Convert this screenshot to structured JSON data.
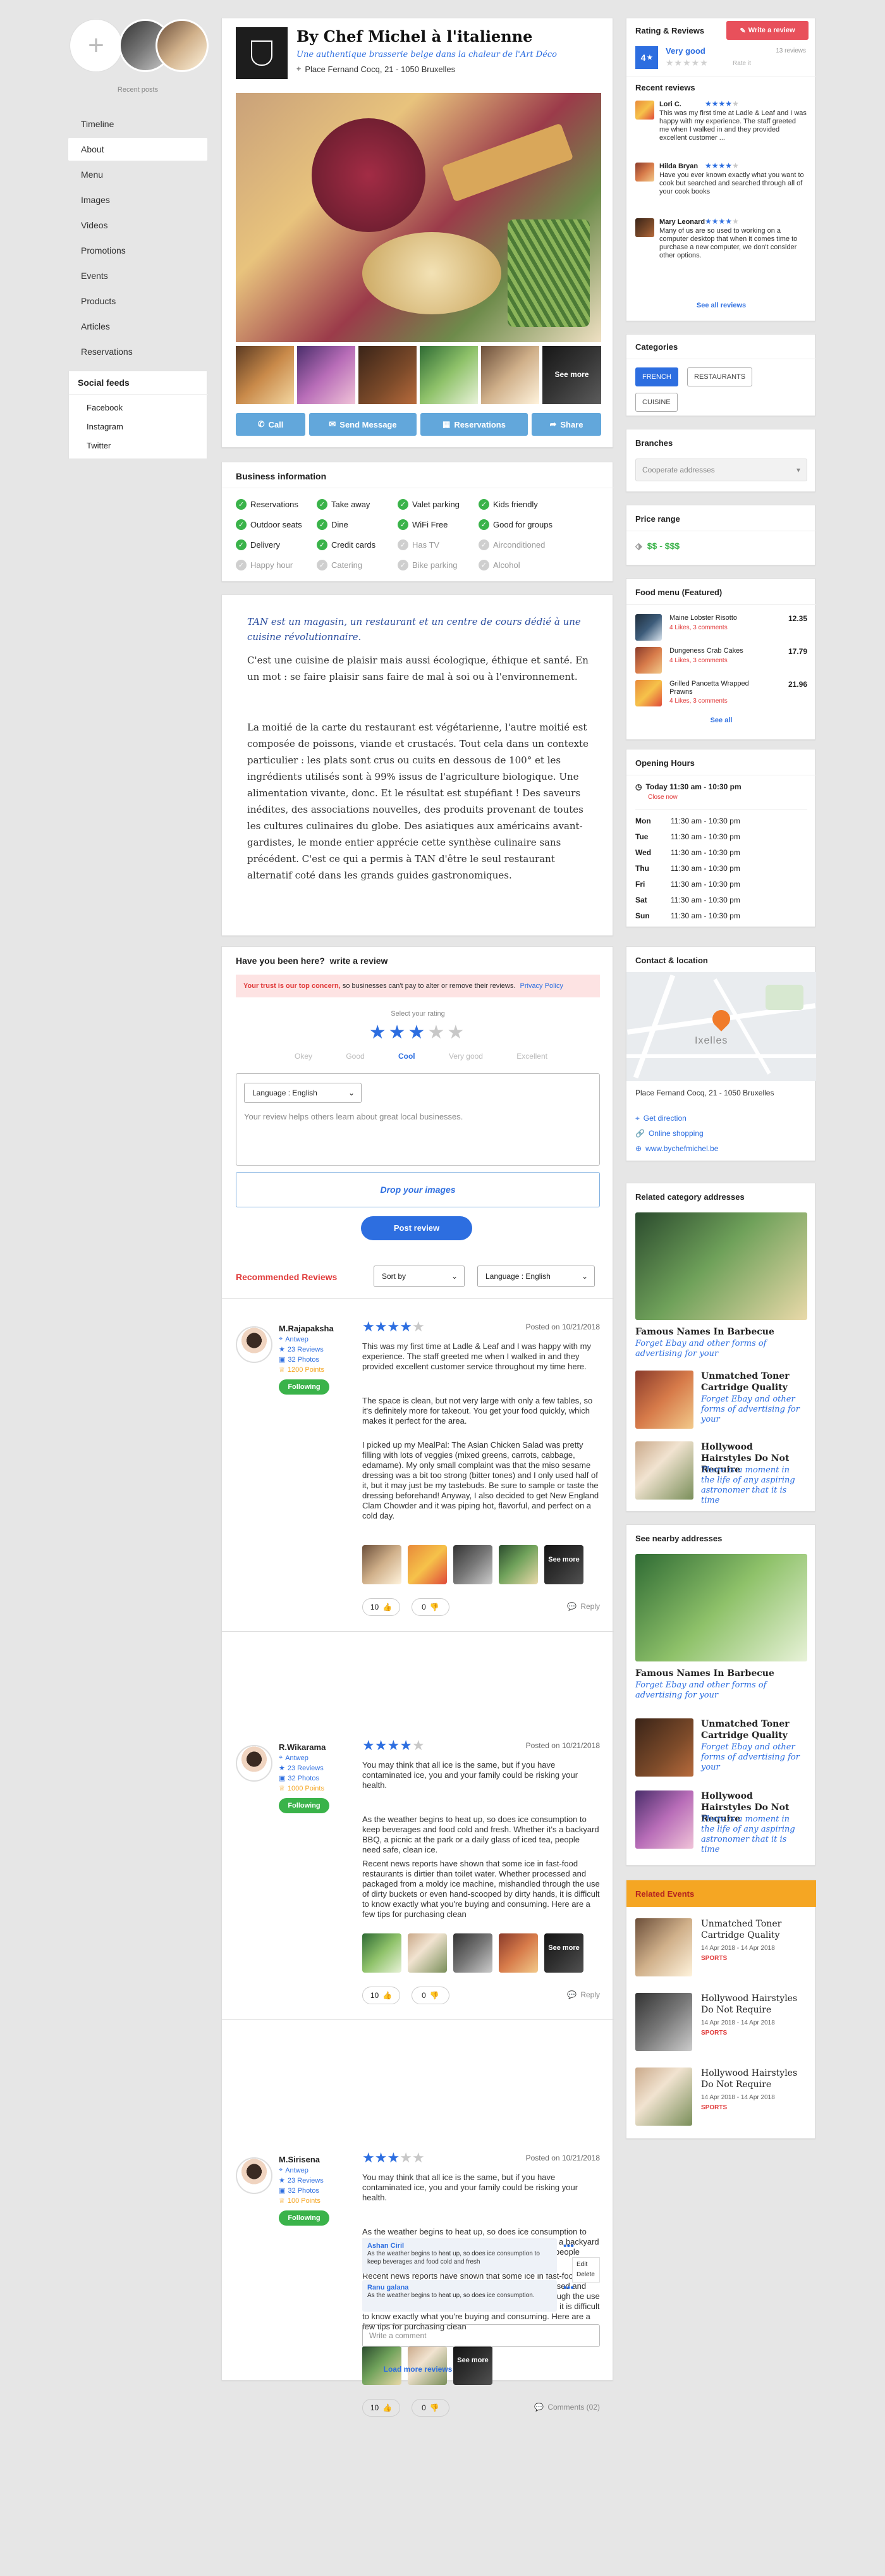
{
  "recent_posts": {
    "label": "Recent posts"
  },
  "nav": [
    {
      "label": "Timeline"
    },
    {
      "label": "About"
    },
    {
      "label": "Menu"
    },
    {
      "label": "Images"
    },
    {
      "label": "Videos"
    },
    {
      "label": "Promotions"
    },
    {
      "label": "Events"
    },
    {
      "label": "Products"
    },
    {
      "label": "Articles"
    },
    {
      "label": "Reservations"
    }
  ],
  "social": {
    "title": "Social feeds",
    "items": [
      "Facebook",
      "Instagram",
      "Twitter"
    ]
  },
  "business": {
    "name": "By Chef Michel à l'italienne",
    "tagline": "Une authentique brasserie belge dans la chaleur de l'Art Déco",
    "address": "Place Fernand Cocq, 21 - 1050 Bruxelles",
    "see_more": "See more",
    "actions": [
      "Call",
      "Send Message",
      "Reservations",
      "Share"
    ]
  },
  "business_info": {
    "title": "Business information",
    "items": [
      {
        "label": "Reservations",
        "on": true
      },
      {
        "label": "Take away",
        "on": true
      },
      {
        "label": "Valet parking",
        "on": true
      },
      {
        "label": "Kids friendly",
        "on": true
      },
      {
        "label": "Outdoor seats",
        "on": true
      },
      {
        "label": "Dine",
        "on": true
      },
      {
        "label": "WiFi Free",
        "on": true
      },
      {
        "label": "Good for groups",
        "on": true
      },
      {
        "label": "Delivery",
        "on": true
      },
      {
        "label": "Credit cards",
        "on": true
      },
      {
        "label": "Has TV",
        "on": false
      },
      {
        "label": "Airconditioned",
        "on": false
      },
      {
        "label": "Happy hour",
        "on": false
      },
      {
        "label": "Catering",
        "on": false
      },
      {
        "label": "Bike parking",
        "on": false
      },
      {
        "label": "Alcohol",
        "on": false
      }
    ]
  },
  "about": {
    "lead": "TAN est un magasin, un restaurant et un centre de cours dédié à une cuisine révolutionnaire.",
    "p1": "C'est une cuisine de plaisir mais aussi écologique, éthique et santé. En un mot : se faire plaisir sans faire de mal à soi ou à l'environnement.",
    "p2": "La moitié de la carte du restaurant est végétarienne, l'autre moitié est composée de poissons, viande et crustacés. Tout cela dans un contexte particulier : les plats sont crus ou cuits en dessous de 100° et les ingrédients utilisés sont à 99% issus de l'agriculture biologique. Une alimentation vivante, donc. Et le résultat est stupéfiant ! Des saveurs inédites, des associations nouvelles, des produits provenant de toutes les cultures culinaires du globe. Des asiatiques aux américains avant-gardistes, le monde entier apprécie cette synthèse culinaire sans précédent. C'est ce qui a permis à TAN d'être le seul restaurant alternatif coté dans les grands guides gastronomiques."
  },
  "write_review": {
    "q": "Have you been here?",
    "link": "write a review",
    "trust_bold": "Your trust is our top concern,",
    "trust_rest": " so businesses can't pay to alter or remove their reviews.",
    "policy": "Privacy Policy",
    "select_rating": "Select your rating",
    "rating_value": 3,
    "levels": [
      "Okey",
      "Good",
      "Cool",
      "Very good",
      "Excellent"
    ],
    "active_level": "Cool",
    "language": "Language : English",
    "placeholder": "Your review helps others learn about great local businesses.",
    "drop": "Drop your images",
    "post": "Post review"
  },
  "recommended": {
    "title": "Recommended Reviews",
    "sort": "Sort by",
    "language": "Language : English",
    "reviews": [
      {
        "name": "M.Rajapaksha",
        "city": "Antwep",
        "reviews": "23 Reviews",
        "photos": "32 Photos",
        "points": "1200 Points",
        "follow": "Following",
        "rating": 4,
        "date": "Posted on 10/21/2018",
        "paras": [
          "This was my first time at Ladle & Leaf and I was happy with my experience. The staff greeted me when I walked in and they provided excellent customer service throughout my time here.",
          "The space is clean, but not very large with only a few tables, so it's definitely more for takeout. You get your food quickly, which makes it perfect for the area.",
          "I picked up my MealPal: The Asian Chicken Salad was pretty filling with lots of veggies (mixed greens, carrots, cabbage, edamame). My only small complaint was that the miso sesame dressing was a bit too strong (bitter tones) and I only used half of it, but it may just be my tastebuds. Be sure to sample or taste the dressing beforehand! Anyway, I also decided to get New England Clam Chowder and it was piping hot, flavorful, and perfect on a cold day."
        ],
        "see_more": "See more",
        "likes": "10",
        "dislikes": "0",
        "reply": "Reply"
      },
      {
        "name": "R.Wikarama",
        "city": "Antwep",
        "reviews": "23 Reviews",
        "photos": "32 Photos",
        "points": "1000 Points",
        "follow": "Following",
        "rating": 4,
        "date": "Posted on 10/21/2018",
        "paras": [
          "You may think that all ice is the same, but if you have contaminated ice, you and your family could be risking your health.",
          "As the weather begins to heat up, so does ice consumption to keep beverages and food cold and fresh. Whether it's a backyard BBQ, a picnic at the park or a daily glass of iced tea, people need safe, clean ice.",
          "Recent news reports have shown that some ice in fast-food restaurants is dirtier than toilet water. Whether processed and packaged from a moldy ice machine, mishandled through the use of dirty buckets or even hand-scooped by dirty hands, it is difficult to know exactly what you're buying and consuming. Here are a few tips for purchasing clean"
        ],
        "see_more": "See more",
        "likes": "10",
        "dislikes": "0",
        "reply": "Reply"
      },
      {
        "name": "M.Sirisena",
        "city": "Antwep",
        "reviews": "23 Reviews",
        "photos": "32 Photos",
        "points": "100 Points",
        "follow": "Following",
        "rating": 3,
        "date": "Posted on 10/21/2018",
        "paras": [
          "You may think that all ice is the same, but if you have contaminated ice, you and your family could be risking your health.",
          "As the weather begins to heat up, so does ice consumption to keep beverages and food cold and fresh. Whether it's a backyard BBQ, a picnic at the park or a daily glass of iced tea, people need safe, clean ice.",
          "Recent news reports have shown that some ice in fast-food restaurants is dirtier than toilet water. Whether processed and packaged from a moldy ice machine, mishandled through the use of dirty buckets or even hand-scooped by dirty hands, it is difficult to know exactly what you're buying and consuming. Here are a few tips for purchasing clean"
        ],
        "see_more": "See more",
        "likes": "10",
        "dislikes": "0",
        "comments": "Comments (02)"
      }
    ],
    "comments": [
      {
        "name": "Ashan Ciril",
        "text": "As the weather begins to heat up, so does ice consumption to keep beverages and food cold and fresh"
      },
      {
        "name": "Ranu galana",
        "text": "As the weather begins to heat up, so does ice consumption."
      }
    ],
    "menu": [
      "Edit",
      "Delete"
    ],
    "comment_placeholder": "Write a comment",
    "load_more": "Load more reviews"
  },
  "rating_reviews": {
    "title": "Rating & Reviews",
    "write": "Write a review",
    "score": "4",
    "score_label": "Very good",
    "count": "13 reviews",
    "rate_it": "Rate it",
    "recent_title": "Recent reviews",
    "recent": [
      {
        "name": "Lori C.",
        "rating": 4,
        "text": "This was my first time at Ladle & Leaf and I was happy with my experience. The staff greeted me when I walked in and they provided excellent customer ..."
      },
      {
        "name": "Hilda Bryan",
        "rating": 4,
        "text": "Have you ever known exactly what you want to cook but searched and searched through all of your cook books"
      },
      {
        "name": "Mary Leonard",
        "rating": 4,
        "text": "Many of us are so used to working on a computer desktop that when it comes time to purchase a new computer, we don't consider other options."
      }
    ],
    "see_all": "See all reviews"
  },
  "categories": {
    "title": "Categories",
    "items": [
      "FRENCH",
      "RESTAURANTS",
      "CUISINE"
    ]
  },
  "branches": {
    "title": "Branches",
    "select": "Cooperate addresses"
  },
  "price": {
    "title": "Price range",
    "value": "$$ - $$$"
  },
  "food_menu": {
    "title": "Food menu (Featured)",
    "items": [
      {
        "name": "Maine Lobster Risotto",
        "meta": "4 Likes, 3 comments",
        "price": "12.35"
      },
      {
        "name": "Dungeness Crab Cakes",
        "meta": "4 Likes, 3 comments",
        "price": "17.79"
      },
      {
        "name": "Grilled Pancetta Wrapped Prawns",
        "meta": "4 Likes, 3 comments",
        "price": "21.96"
      }
    ],
    "see_all": "See all"
  },
  "hours": {
    "title": "Opening Hours",
    "today": "Today 11:30 am - 10:30 pm",
    "status": "Close now",
    "days": [
      {
        "d": "Mon",
        "h": "11:30 am - 10:30 pm"
      },
      {
        "d": "Tue",
        "h": "11:30 am - 10:30 pm"
      },
      {
        "d": "Wed",
        "h": "11:30 am - 10:30 pm"
      },
      {
        "d": "Thu",
        "h": "11:30 am - 10:30 pm"
      },
      {
        "d": "Fri",
        "h": "11:30 am - 10:30 pm"
      },
      {
        "d": "Sat",
        "h": "11:30 am - 10:30 pm"
      },
      {
        "d": "Sun",
        "h": "11:30 am - 10:30 pm"
      }
    ]
  },
  "contact": {
    "title": "Contact & location",
    "map_label": "Ixelles",
    "address": "Place Fernand Cocq, 21 - 1050 Bruxelles",
    "links": [
      "Get direction",
      "Online shopping",
      "www.bychefmichel.be"
    ]
  },
  "related": {
    "title": "Related category addresses",
    "feature_title": "Famous Names In Barbecue",
    "feature_sub": "Forget Ebay and other forms of advertising for your",
    "items": [
      {
        "t": "Unmatched Toner Cartridge Quality",
        "s": "Forget Ebay and other forms of advertising for your"
      },
      {
        "t": "Hollywood Hairstyles Do Not Require",
        "s": "There is a moment in the life of any aspiring astronomer that it is time"
      }
    ]
  },
  "nearby": {
    "title": "See nearby addresses",
    "feature_title": "Famous Names In Barbecue",
    "feature_sub": "Forget Ebay and other forms of advertising for your",
    "items": [
      {
        "t": "Unmatched Toner Cartridge Quality",
        "s": "Forget Ebay and other forms of advertising for your"
      },
      {
        "t": "Hollywood Hairstyles Do Not Require",
        "s": "There is a moment in the life of any aspiring astronomer that it is time"
      }
    ]
  },
  "events": {
    "title": "Related Events",
    "items": [
      {
        "t": "Unmatched Toner Cartridge Quality",
        "d": "14 Apr 2018 - 14 Apr 2018",
        "c": "SPORTS"
      },
      {
        "t": "Hollywood Hairstyles Do Not Require",
        "d": "14 Apr 2018 - 14 Apr 2018",
        "c": "SPORTS"
      },
      {
        "t": "Hollywood Hairstyles Do Not Require",
        "d": "14 Apr 2018 - 14 Apr 2018",
        "c": "SPORTS"
      }
    ]
  },
  "colors": {
    "accent": "#2d6ee0",
    "action": "#62a7db",
    "danger": "#e03a3a",
    "success": "#3ab34a",
    "events": "#f5a623"
  },
  "icons": [
    "plus-icon",
    "map-pin-icon",
    "phone-icon",
    "envelope-icon",
    "calendar-icon",
    "share-icon",
    "check-icon",
    "star-icon",
    "thumbs-up-icon",
    "thumbs-down-icon",
    "chat-icon",
    "clock-icon",
    "tag-icon",
    "link-icon",
    "chevron-down-icon",
    "more-icon"
  ]
}
